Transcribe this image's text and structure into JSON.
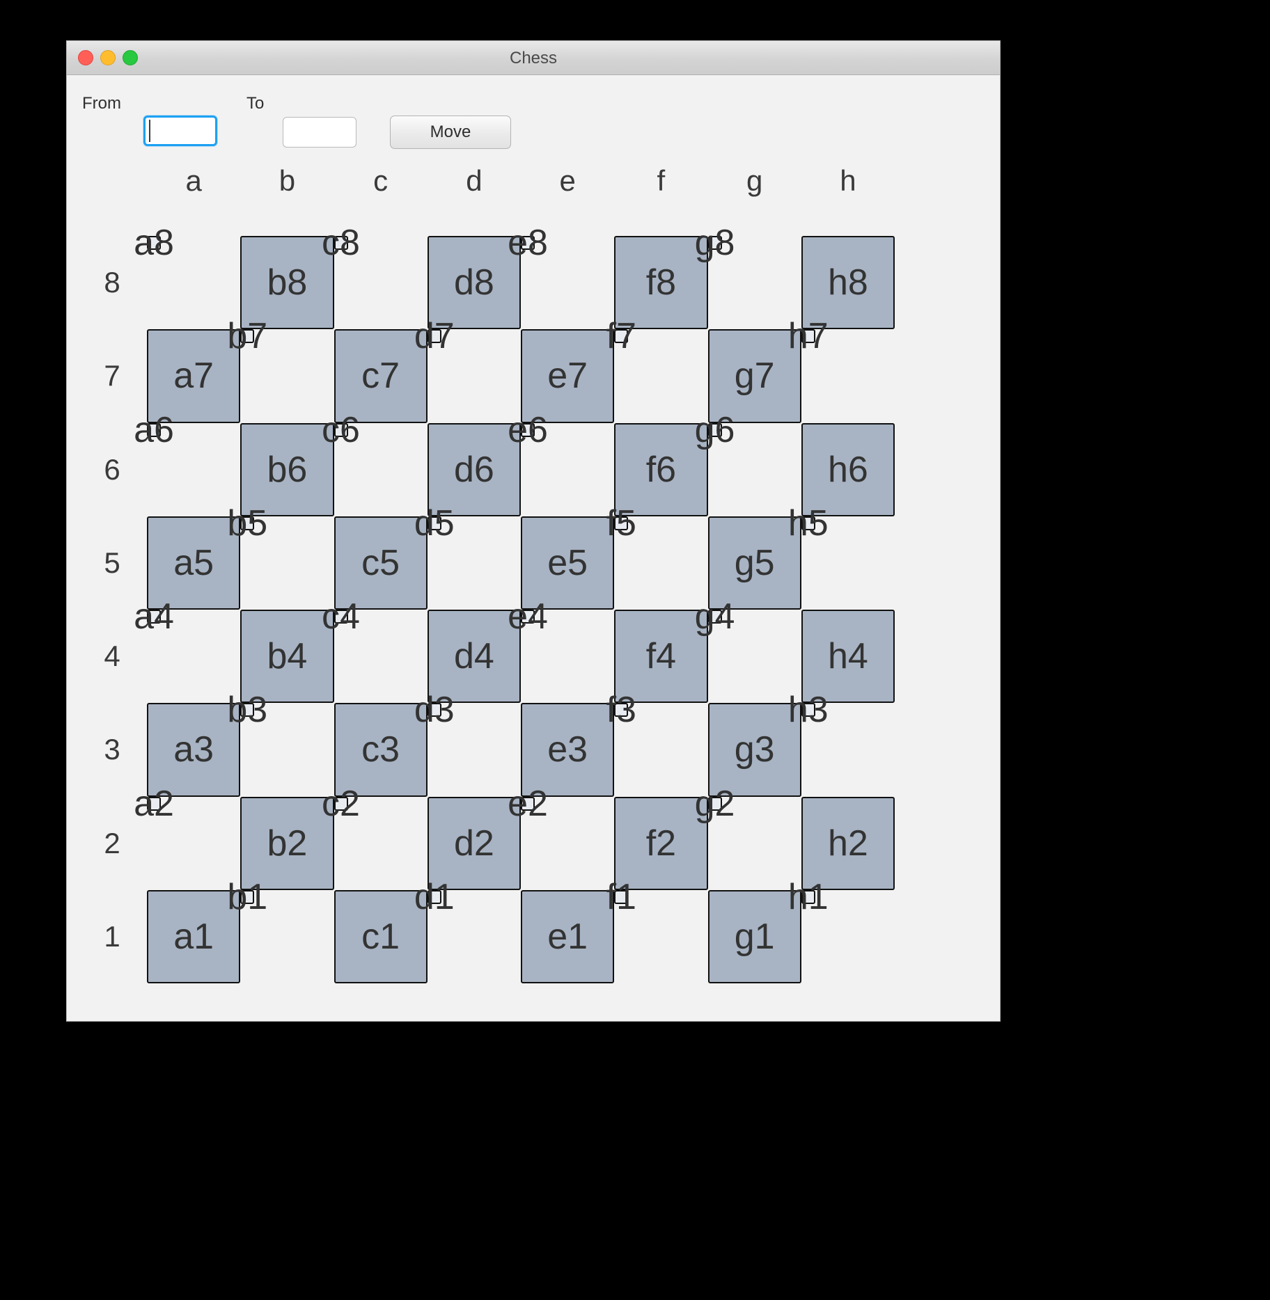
{
  "window": {
    "title": "Chess",
    "traffic_lights": [
      {
        "name": "close",
        "color": "#ff5f57"
      },
      {
        "name": "minimize",
        "color": "#ffbd2e"
      },
      {
        "name": "zoom",
        "color": "#28c840"
      }
    ]
  },
  "toolbar": {
    "from_label": "From",
    "from_value": "",
    "to_label": "To",
    "to_value": "",
    "move_label": "Move"
  },
  "board": {
    "files": [
      "a",
      "b",
      "c",
      "d",
      "e",
      "f",
      "g",
      "h"
    ],
    "ranks": [
      "8",
      "7",
      "6",
      "5",
      "4",
      "3",
      "2",
      "1"
    ],
    "light_color": "#e8ecf1",
    "dark_color": "#a8b4c4",
    "squares": [
      [
        {
          "label": "a8",
          "shade": "light"
        },
        {
          "label": "b8",
          "shade": "dark"
        },
        {
          "label": "c8",
          "shade": "light"
        },
        {
          "label": "d8",
          "shade": "dark"
        },
        {
          "label": "e8",
          "shade": "light"
        },
        {
          "label": "f8",
          "shade": "dark"
        },
        {
          "label": "g8",
          "shade": "light"
        },
        {
          "label": "h8",
          "shade": "dark"
        }
      ],
      [
        {
          "label": "a7",
          "shade": "dark"
        },
        {
          "label": "b7",
          "shade": "light"
        },
        {
          "label": "c7",
          "shade": "dark"
        },
        {
          "label": "d7",
          "shade": "light"
        },
        {
          "label": "e7",
          "shade": "dark"
        },
        {
          "label": "f7",
          "shade": "light"
        },
        {
          "label": "g7",
          "shade": "dark"
        },
        {
          "label": "h7",
          "shade": "light"
        }
      ],
      [
        {
          "label": "a6",
          "shade": "light"
        },
        {
          "label": "b6",
          "shade": "dark"
        },
        {
          "label": "c6",
          "shade": "light"
        },
        {
          "label": "d6",
          "shade": "dark"
        },
        {
          "label": "e6",
          "shade": "light"
        },
        {
          "label": "f6",
          "shade": "dark"
        },
        {
          "label": "g6",
          "shade": "light"
        },
        {
          "label": "h6",
          "shade": "dark"
        }
      ],
      [
        {
          "label": "a5",
          "shade": "dark"
        },
        {
          "label": "b5",
          "shade": "light"
        },
        {
          "label": "c5",
          "shade": "dark"
        },
        {
          "label": "d5",
          "shade": "light"
        },
        {
          "label": "e5",
          "shade": "dark"
        },
        {
          "label": "f5",
          "shade": "light"
        },
        {
          "label": "g5",
          "shade": "dark"
        },
        {
          "label": "h5",
          "shade": "light"
        }
      ],
      [
        {
          "label": "a4",
          "shade": "light"
        },
        {
          "label": "b4",
          "shade": "dark"
        },
        {
          "label": "c4",
          "shade": "light"
        },
        {
          "label": "d4",
          "shade": "dark"
        },
        {
          "label": "e4",
          "shade": "light"
        },
        {
          "label": "f4",
          "shade": "dark"
        },
        {
          "label": "g4",
          "shade": "light"
        },
        {
          "label": "h4",
          "shade": "dark"
        }
      ],
      [
        {
          "label": "a3",
          "shade": "dark"
        },
        {
          "label": "b3",
          "shade": "light"
        },
        {
          "label": "c3",
          "shade": "dark"
        },
        {
          "label": "d3",
          "shade": "light"
        },
        {
          "label": "e3",
          "shade": "dark"
        },
        {
          "label": "f3",
          "shade": "light"
        },
        {
          "label": "g3",
          "shade": "dark"
        },
        {
          "label": "h3",
          "shade": "light"
        }
      ],
      [
        {
          "label": "a2",
          "shade": "light"
        },
        {
          "label": "b2",
          "shade": "dark"
        },
        {
          "label": "c2",
          "shade": "light"
        },
        {
          "label": "d2",
          "shade": "dark"
        },
        {
          "label": "e2",
          "shade": "light"
        },
        {
          "label": "f2",
          "shade": "dark"
        },
        {
          "label": "g2",
          "shade": "light"
        },
        {
          "label": "h2",
          "shade": "dark"
        }
      ],
      [
        {
          "label": "a1",
          "shade": "dark"
        },
        {
          "label": "b1",
          "shade": "light"
        },
        {
          "label": "c1",
          "shade": "dark"
        },
        {
          "label": "d1",
          "shade": "light"
        },
        {
          "label": "e1",
          "shade": "dark"
        },
        {
          "label": "f1",
          "shade": "light"
        },
        {
          "label": "g1",
          "shade": "dark"
        },
        {
          "label": "h1",
          "shade": "light"
        }
      ]
    ]
  }
}
